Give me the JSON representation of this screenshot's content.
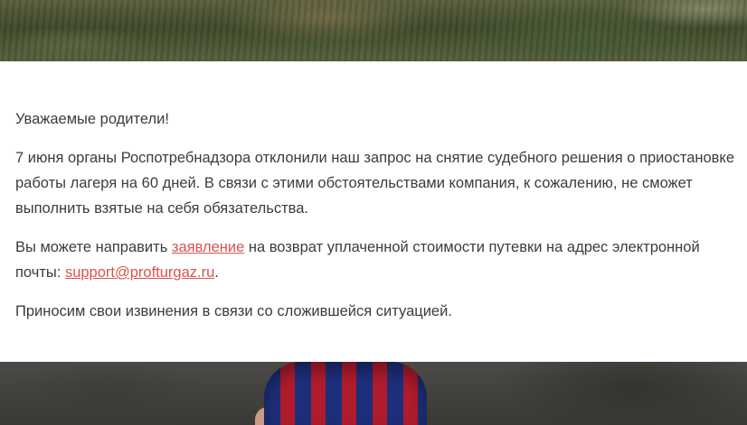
{
  "notice": {
    "greeting": "Уважаемые родители!",
    "paragraph1": "7 июня органы Роспотребнадзора отклонили наш запрос на снятие судебного решения о приостановке работы лагеря  на 60 дней. В связи с этими обстоятельствами компания, к сожалению, не сможет выполнить взятые на себя обязательства.",
    "paragraph2_before_link": "Вы можете направить ",
    "application_link": "заявление",
    "paragraph2_middle": " на возврат уплаченной стоимости путевки на адрес электронной почты: ",
    "email_link": "support@profturgaz.ru",
    "paragraph2_end": ".",
    "apology": "Приносим свои извинения в связи со сложившейся ситуацией."
  },
  "colors": {
    "text": "#3c3c3c",
    "link": "#d9534f",
    "background": "#ffffff"
  }
}
